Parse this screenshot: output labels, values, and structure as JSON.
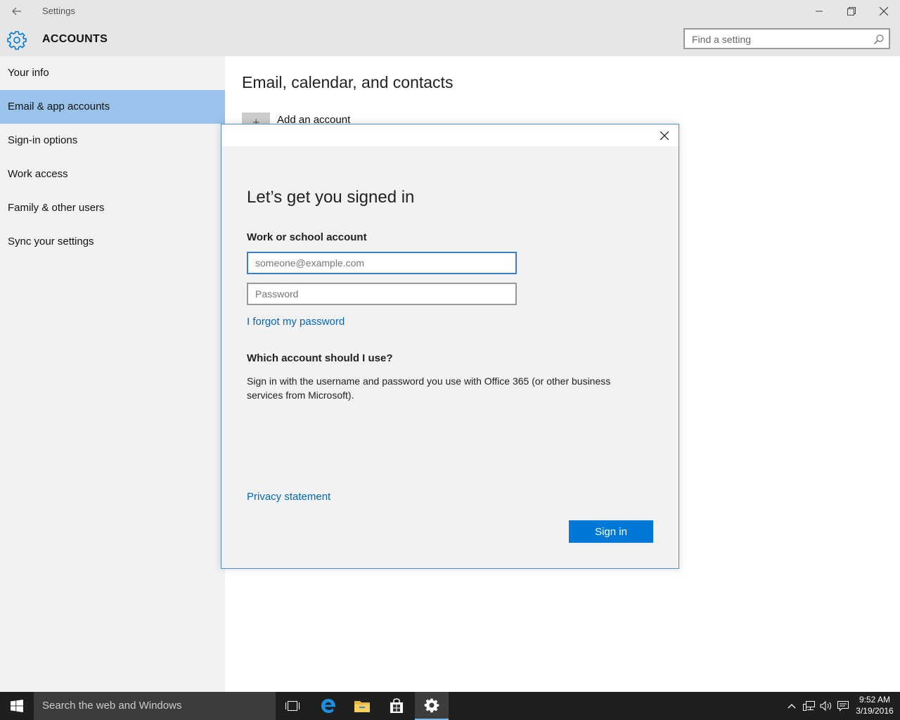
{
  "window": {
    "title": "Settings"
  },
  "header": {
    "title": "ACCOUNTS",
    "search_placeholder": "Find a setting"
  },
  "sidebar": {
    "items": [
      {
        "label": "Your info"
      },
      {
        "label": "Email & app accounts",
        "selected": true
      },
      {
        "label": "Sign-in options"
      },
      {
        "label": "Work access"
      },
      {
        "label": "Family & other users"
      },
      {
        "label": "Sync your settings"
      }
    ]
  },
  "content": {
    "title": "Email, calendar, and contacts",
    "add_account": "Add an account"
  },
  "dialog": {
    "heading": "Let’s get you signed in",
    "account_label": "Work or school account",
    "email_placeholder": "someone@example.com",
    "password_placeholder": "Password",
    "forgot_link": "I forgot my password",
    "question_title": "Which account should I use?",
    "question_body": "Sign in with the username and password you use with Office 365 (or other business services from Microsoft).",
    "privacy_link": "Privacy statement",
    "signin_label": "Sign in"
  },
  "taskbar": {
    "search_placeholder": "Search the web and Windows",
    "time": "9:52 AM",
    "date": "3/19/2016"
  },
  "colors": {
    "accent": "#0078d7",
    "selection": "#99c3ea",
    "link": "#0067b8"
  }
}
